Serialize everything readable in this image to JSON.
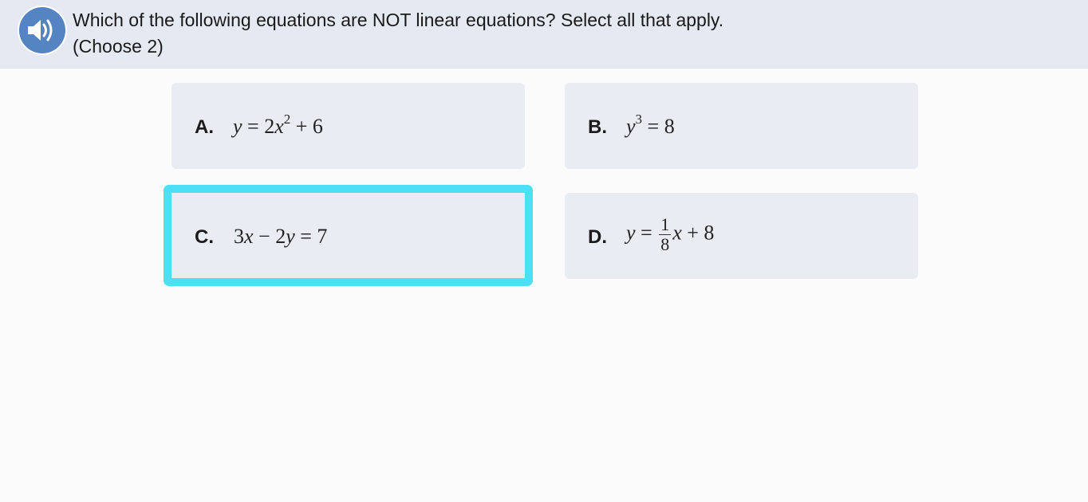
{
  "question": {
    "line1": "Which of the following equations are NOT linear equations? Select all that apply.",
    "line2": "(Choose 2)"
  },
  "audio_icon": "speaker-icon",
  "colors": {
    "header_bg": "#e4e9f2",
    "audio_button": "#5584c3",
    "option_bg": "#e9ecf3",
    "selected_border": "#4cdff6"
  },
  "options": [
    {
      "letter": "A.",
      "selected": false,
      "eq": {
        "lhs": "y",
        "eqsign": "=",
        "coef": "2",
        "var": "x",
        "exp": "2",
        "rest": "+ 6"
      }
    },
    {
      "letter": "B.",
      "selected": false,
      "eq": {
        "var": "y",
        "exp": "3",
        "rest": "= 8"
      }
    },
    {
      "letter": "C.",
      "selected": true,
      "eq": {
        "t1": "3",
        "v1": "x",
        "op": "− 2",
        "v2": "y",
        "rest": "= 7"
      }
    },
    {
      "letter": "D.",
      "selected": false,
      "eq": {
        "lhs": "y",
        "eqsign": "=",
        "num": "1",
        "den": "8",
        "var": "x",
        "rest": "+ 8"
      }
    }
  ]
}
